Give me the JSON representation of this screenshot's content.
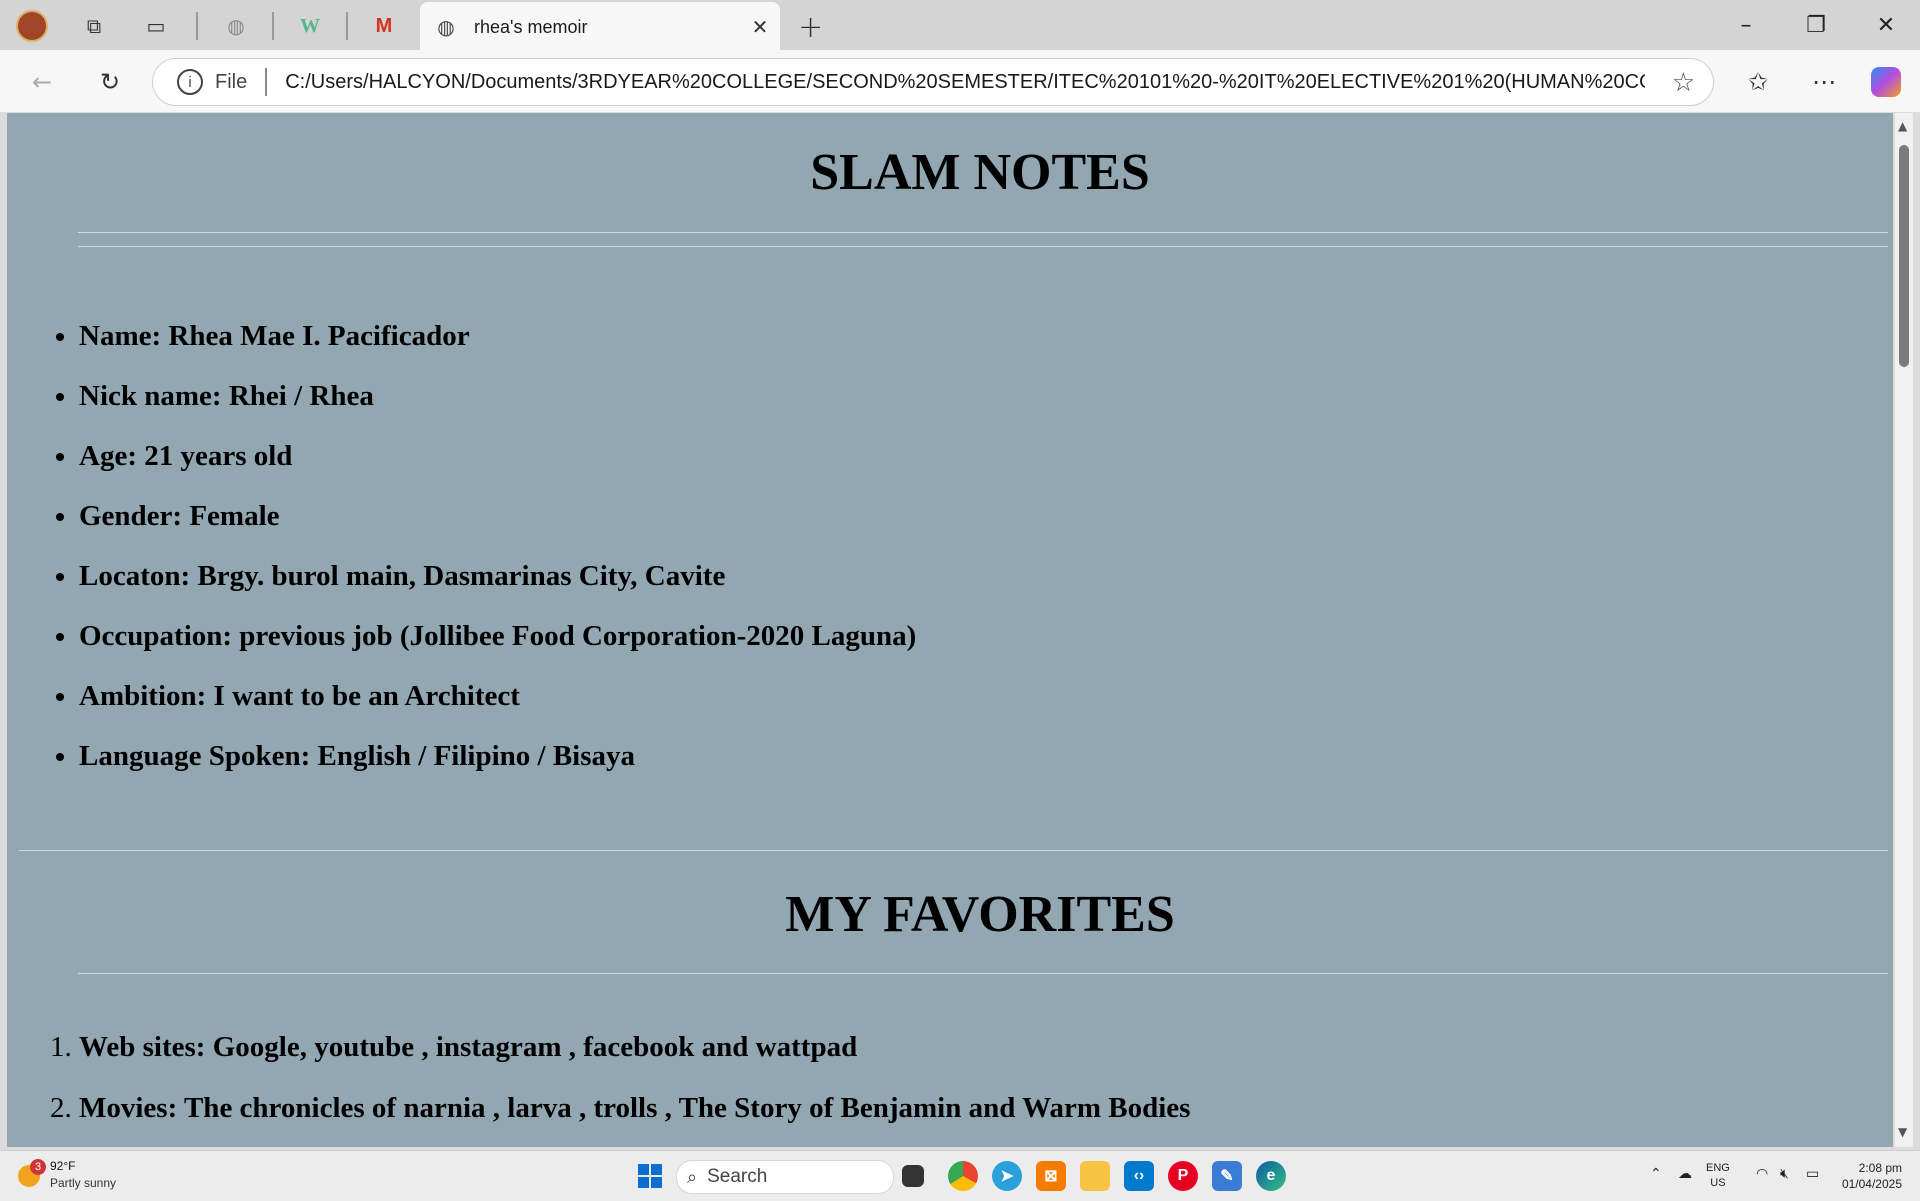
{
  "browser": {
    "tab_title": "rhea's memoir",
    "address_prefix": "File",
    "url": "C:/Users/HALCYON/Documents/3RDYEAR%20COLLEGE/SECOND%20SEMESTER/ITEC%20101%20-%20IT%20ELECTIVE%201%20(HUMAN%20CO..."
  },
  "page": {
    "background_color": "#92a7b2",
    "heading1": "SLAM NOTES",
    "info_items": [
      "Name: Rhea Mae I. Pacificador",
      "Nick name: Rhei / Rhea",
      "Age: 21 years old",
      "Gender: Female",
      "Locaton: Brgy. burol main, Dasmarinas City, Cavite",
      "Occupation: previous job (Jollibee Food Corporation-2020 Laguna)",
      "Ambition: I want to be an Architect",
      "Language Spoken: English / Filipino / Bisaya"
    ],
    "heading2": "MY FAVORITES",
    "favorites": [
      "Web sites: Google, youtube , instagram , facebook and wattpad",
      "Movies: The chronicles of narnia , larva , trolls , The Story of Benjamin and Warm Bodies"
    ]
  },
  "taskbar": {
    "weather_badge": "3",
    "temperature": "92°F",
    "weather_condition": "Partly sunny",
    "search_label": "Search",
    "language_top": "ENG",
    "language_bottom": "US",
    "time": "2:08 pm",
    "date": "01/04/2025"
  }
}
